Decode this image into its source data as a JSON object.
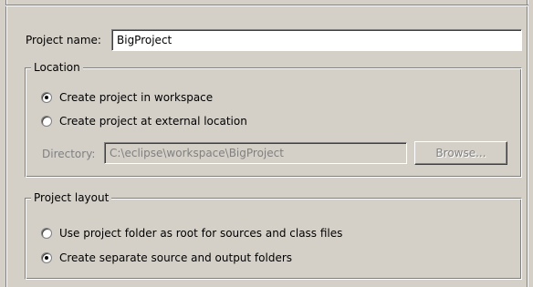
{
  "project_name": {
    "label": "Project name:",
    "value": "BigProject"
  },
  "location": {
    "title": "Location",
    "options": [
      {
        "label": "Create project in workspace",
        "checked": true
      },
      {
        "label": "Create project at external location",
        "checked": false
      }
    ],
    "directory_label": "Directory:",
    "directory_value": "C:\\eclipse\\workspace\\BigProject",
    "browse_label": "Browse..."
  },
  "layout": {
    "title": "Project layout",
    "options": [
      {
        "label": "Use project folder as root for sources and class files",
        "checked": false
      },
      {
        "label": "Create separate source and output folders",
        "checked": true
      }
    ]
  }
}
